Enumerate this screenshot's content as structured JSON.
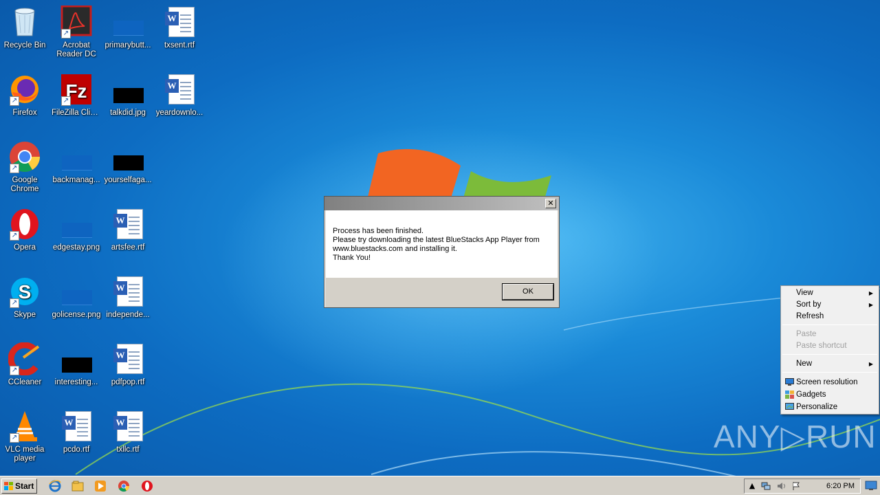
{
  "desktop": {
    "icons": [
      {
        "label": "Recycle Bin",
        "icon": "recycle-bin-icon"
      },
      {
        "label": "Acrobat Reader DC",
        "icon": "acrobat-icon"
      },
      {
        "label": "primarybutt...",
        "icon": "image-file-icon"
      },
      {
        "label": "txsent.rtf",
        "icon": "word-doc-icon"
      },
      {
        "label": "Firefox",
        "icon": "firefox-icon"
      },
      {
        "label": "FileZilla Client",
        "icon": "filezilla-icon"
      },
      {
        "label": "talkdid.jpg",
        "icon": "image-file-icon"
      },
      {
        "label": "yeardownlo...",
        "icon": "word-doc-icon"
      },
      {
        "label": "Google Chrome",
        "icon": "chrome-icon"
      },
      {
        "label": "backmanag...",
        "icon": "image-file-icon"
      },
      {
        "label": "yourselfaga...",
        "icon": "image-file-icon"
      },
      {
        "label": "Opera",
        "icon": "opera-icon"
      },
      {
        "label": "edgestay.png",
        "icon": "image-file-icon"
      },
      {
        "label": "artsfee.rtf",
        "icon": "word-doc-icon"
      },
      {
        "label": "Skype",
        "icon": "skype-icon"
      },
      {
        "label": "golicense.png",
        "icon": "image-file-icon"
      },
      {
        "label": "independe...",
        "icon": "word-doc-icon"
      },
      {
        "label": "CCleaner",
        "icon": "ccleaner-icon"
      },
      {
        "label": "interesting...",
        "icon": "image-file-icon"
      },
      {
        "label": "pdfpop.rtf",
        "icon": "word-doc-icon"
      },
      {
        "label": "VLC media player",
        "icon": "vlc-icon"
      },
      {
        "label": "pcdo.rtf",
        "icon": "word-doc-icon"
      },
      {
        "label": "txllc.rtf",
        "icon": "word-doc-icon"
      }
    ]
  },
  "dialog": {
    "title": "",
    "close_label": "✕",
    "lines": [
      "Process has been finished.",
      "Please try downloading the latest BlueStacks App Player from",
      "www.bluestacks.com and installing it.",
      "Thank You!"
    ],
    "ok_label": "OK"
  },
  "context_menu": {
    "items": [
      {
        "label": "View",
        "submenu": true,
        "enabled": true
      },
      {
        "label": "Sort by",
        "submenu": true,
        "enabled": true
      },
      {
        "label": "Refresh",
        "submenu": false,
        "enabled": true
      },
      {
        "label": "Paste",
        "submenu": false,
        "enabled": false
      },
      {
        "label": "Paste shortcut",
        "submenu": false,
        "enabled": false
      },
      {
        "label": "New",
        "submenu": true,
        "enabled": true
      },
      {
        "label": "Screen resolution",
        "submenu": false,
        "enabled": true,
        "icon": "screen-resolution-icon"
      },
      {
        "label": "Gadgets",
        "submenu": false,
        "enabled": true,
        "icon": "gadgets-icon"
      },
      {
        "label": "Personalize",
        "submenu": false,
        "enabled": true,
        "icon": "personalize-icon"
      }
    ]
  },
  "taskbar": {
    "start_label": "Start",
    "pinned": [
      "internet-explorer-icon",
      "explorer-icon",
      "media-player-icon",
      "chrome-icon",
      "opera-icon"
    ],
    "tray": {
      "icons": [
        "show-hidden-icons-icon",
        "network-icon",
        "volume-icon",
        "action-center-flag-icon"
      ],
      "time": "6:20 PM"
    }
  },
  "watermark": "ANY▷RUN",
  "colors": {
    "desktop_blue": "#1a8ad8",
    "dialog_face": "#d4d0c8",
    "taskbar": "#d4d0c8"
  }
}
